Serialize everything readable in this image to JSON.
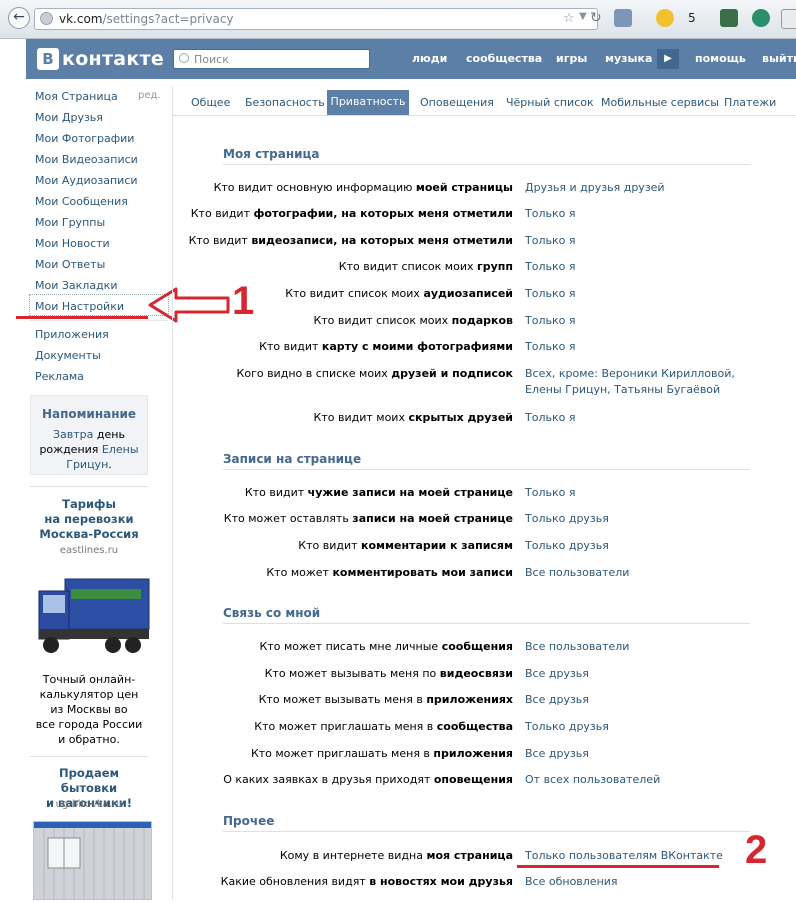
{
  "browser": {
    "url_host": "vk.com",
    "url_path": "/settings?act=privacy",
    "weather_count": "5"
  },
  "header": {
    "logo_b": "B",
    "logo_text": "контакте",
    "search_placeholder": "Поиск",
    "nav": [
      "люди",
      "сообщества",
      "игры",
      "музыка",
      "помощь",
      "выйти"
    ]
  },
  "sidebar": {
    "edit_label": "ред.",
    "items": [
      "Моя Страница",
      "Мои Друзья",
      "Мои Фотографии",
      "Мои Видеозаписи",
      "Мои Аудиозаписи",
      "Мои Сообщения",
      "Мои Группы",
      "Мои Новости",
      "Мои Ответы",
      "Мои Закладки",
      "Мои Настройки"
    ],
    "extra_items": [
      "Приложения",
      "Документы",
      "Реклама"
    ],
    "reminder": {
      "title": "Напоминание",
      "line1_link": "Завтра",
      "line1_rest": "день",
      "line2_text": "рождения",
      "line2_link": "Елены",
      "line3_link": "Грицун",
      "line3_rest": "."
    },
    "ads": [
      {
        "title_lines": [
          "Тарифы",
          "на перевозки",
          "Москва-Россия"
        ],
        "host": "eastlines.ru",
        "text_lines": [
          "Точный онлайн-",
          "калькулятор цен",
          "из Москвы во",
          "все города России",
          "и обратно."
        ]
      },
      {
        "title_lines": [
          "Продаем бытовки",
          "и вагончики!"
        ],
        "host": "ug-bitovka.ru"
      }
    ]
  },
  "annotations": {
    "n1": "1",
    "n2": "2"
  },
  "tabs": [
    "Общее",
    "Безопасность",
    "Приватность",
    "Оповещения",
    "Чёрный список",
    "Мобильные сервисы",
    "Платежи"
  ],
  "sections": [
    {
      "title": "Моя страница",
      "rows": [
        {
          "pre": "Кто видит основную информацию ",
          "bold": "моей страницы",
          "post": "",
          "value": "Друзья и друзья друзей"
        },
        {
          "pre": "Кто видит ",
          "bold": "фотографии, на которых меня отметили",
          "post": "",
          "value": "Только я"
        },
        {
          "pre": "Кто видит ",
          "bold": "видеозаписи, на которых меня отметили",
          "post": "",
          "value": "Только я"
        },
        {
          "pre": "Кто видит список моих ",
          "bold": "групп",
          "post": "",
          "value": "Только я"
        },
        {
          "pre": "Кто видит список моих ",
          "bold": "аудиозаписей",
          "post": "",
          "value": "Только я"
        },
        {
          "pre": "Кто видит список моих ",
          "bold": "подарков",
          "post": "",
          "value": "Только я"
        },
        {
          "pre": "Кто видит ",
          "bold": "карту с моими фотографиями",
          "post": "",
          "value": "Только я"
        },
        {
          "pre": "Кого видно в списке моих ",
          "bold": "друзей и подписок",
          "post": "",
          "value": "Всех, кроме: Вероники Кирилловой, Елены Грицун, Татьяны Бугаёвой"
        },
        {
          "pre": "Кто видит моих ",
          "bold": "скрытых друзей",
          "post": "",
          "value": "Только я"
        }
      ]
    },
    {
      "title": "Записи на странице",
      "rows": [
        {
          "pre": "Кто видит ",
          "bold": "чужие записи на моей странице",
          "post": "",
          "value": "Только я"
        },
        {
          "pre": "Кто может оставлять ",
          "bold": "записи на моей странице",
          "post": "",
          "value": "Только друзья"
        },
        {
          "pre": "Кто видит ",
          "bold": "комментарии к записям",
          "post": "",
          "value": "Только друзья"
        },
        {
          "pre": "Кто может ",
          "bold": "комментировать мои записи",
          "post": "",
          "value": "Все пользователи"
        }
      ]
    },
    {
      "title": "Связь со мной",
      "rows": [
        {
          "pre": "Кто может писать мне личные ",
          "bold": "сообщения",
          "post": "",
          "value": "Все пользователи"
        },
        {
          "pre": "Кто может вызывать меня по ",
          "bold": "видеосвязи",
          "post": "",
          "value": "Все друзья"
        },
        {
          "pre": "Кто может вызывать меня в ",
          "bold": "приложениях",
          "post": "",
          "value": "Все друзья"
        },
        {
          "pre": "Кто может приглашать меня в ",
          "bold": "сообщества",
          "post": "",
          "value": "Только друзья"
        },
        {
          "pre": "Кто может приглашать меня в ",
          "bold": "приложения",
          "post": "",
          "value": "Все друзья"
        },
        {
          "pre": "О каких заявках в друзья приходят ",
          "bold": "оповещения",
          "post": "",
          "value": "От всех пользователей"
        }
      ]
    },
    {
      "title": "Прочее",
      "rows": [
        {
          "pre": "Кому в интернете видна ",
          "bold": "моя страница",
          "post": "",
          "value": "Только пользователям ВКонтакте"
        },
        {
          "pre": "Какие обновления видят ",
          "bold": "в новостях мои друзья",
          "post": "",
          "value": "Все обновления"
        }
      ]
    }
  ],
  "colors": {
    "header": "#5b7fa6",
    "link": "#2b587a",
    "section_title": "#45688e",
    "annotation": "#d52730"
  }
}
